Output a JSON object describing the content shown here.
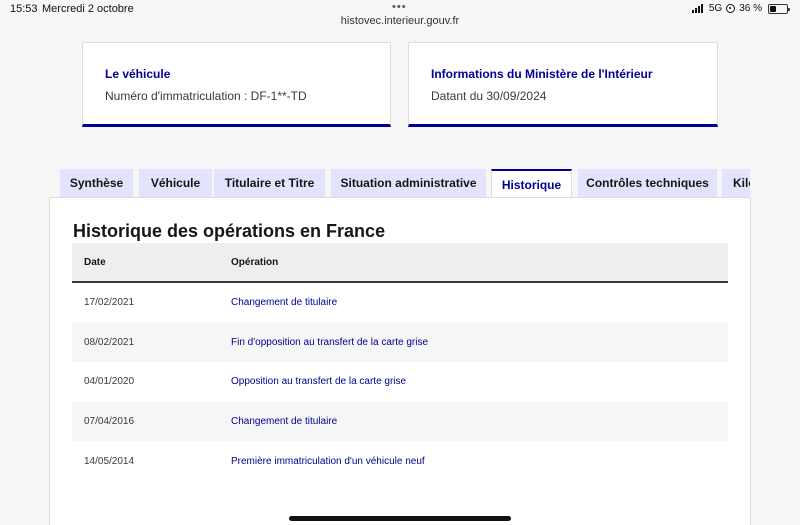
{
  "status_bar": {
    "time": "15:53",
    "date": "Mercredi 2 octobre",
    "url": "histovec.interieur.gouv.fr",
    "network": "5G",
    "battery": "36 %",
    "battery_level": 0.36
  },
  "cards": [
    {
      "title": "Le véhicule",
      "text": "Numéro d'immatriculation : DF-1**-TD"
    },
    {
      "title": "Informations du Ministère de l'Intérieur",
      "text": "Datant du 30/09/2024"
    }
  ],
  "tabs": [
    {
      "label": "Synthèse"
    },
    {
      "label": "Véhicule"
    },
    {
      "label": "Titulaire et Titre"
    },
    {
      "label": "Situation administrative"
    },
    {
      "label": "Historique"
    },
    {
      "label": "Contrôles techniques"
    },
    {
      "label": "Kilo"
    }
  ],
  "active_tab": "Historique",
  "history": {
    "title": "Historique des opérations en France",
    "columns": [
      "Date",
      "Opération"
    ],
    "rows": [
      {
        "date": "17/02/2021",
        "operation": "Changement de titulaire"
      },
      {
        "date": "08/02/2021",
        "operation": "Fin d'opposition au transfert de la carte grise"
      },
      {
        "date": "04/01/2020",
        "operation": "Opposition au transfert de la carte grise"
      },
      {
        "date": "07/04/2016",
        "operation": "Changement de titulaire"
      },
      {
        "date": "14/05/2014",
        "operation": "Première immatriculation d'un véhicule neuf"
      }
    ]
  },
  "colors": {
    "accent": "#000091",
    "tab_background": "#e3e3fd"
  }
}
